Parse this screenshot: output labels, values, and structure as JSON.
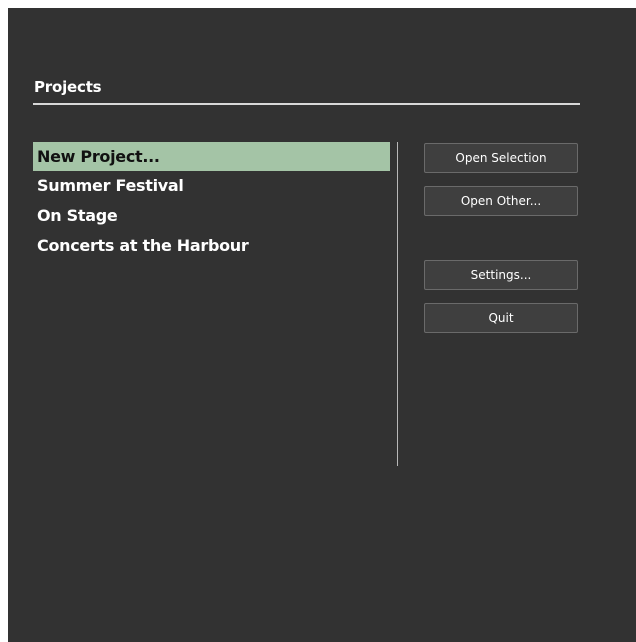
{
  "projects": {
    "title": "Projects",
    "items": [
      {
        "label": "New Project...",
        "selected": true
      },
      {
        "label": "Summer Festival",
        "selected": false
      },
      {
        "label": "On Stage",
        "selected": false
      },
      {
        "label": "Concerts at the Harbour",
        "selected": false
      }
    ]
  },
  "buttons": {
    "open_selection": "Open Selection",
    "open_other": "Open Other...",
    "settings": "Settings...",
    "quit": "Quit"
  },
  "colors": {
    "background": "#323232",
    "selection": "#a4c4a6",
    "button_bg": "#3f3f3f",
    "button_border": "#6a6a6a"
  }
}
